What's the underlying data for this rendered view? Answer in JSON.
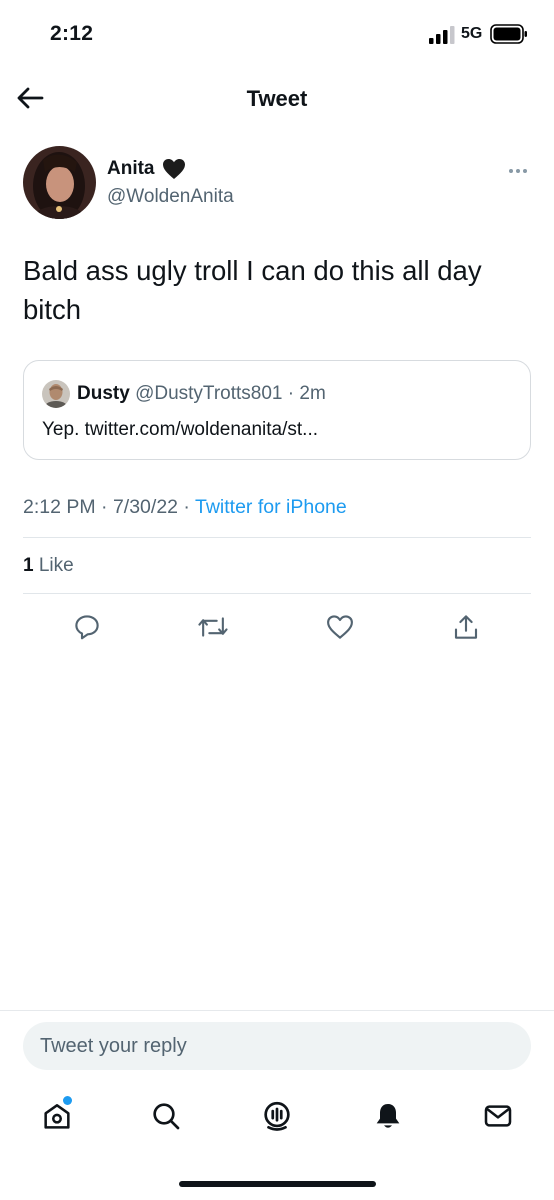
{
  "status_bar": {
    "time": "2:12",
    "network": "5G",
    "icons": [
      "signal-icon",
      "battery-icon"
    ]
  },
  "header": {
    "title": "Tweet",
    "back_icon": "arrow-left-icon"
  },
  "tweet": {
    "author_name": "Anita",
    "author_emoji": "🖤",
    "author_handle": "@WoldenAnita",
    "text": "Bald ass ugly troll I can do this all day bitch",
    "timestamp": "2:12 PM · 7/30/22 · ",
    "source": "Twitter for iPhone",
    "likes_count": "1",
    "likes_label": " Like",
    "more_icon": "more-dots-icon"
  },
  "quote": {
    "name": "Dusty",
    "handle": "@DustyTrotts801",
    "separator": " · ",
    "age": "2m",
    "text": "Yep. twitter.com/woldenanita/st..."
  },
  "actions": [
    "reply-icon",
    "retweet-icon",
    "like-icon",
    "share-icon"
  ],
  "reply": {
    "placeholder": "Tweet your reply"
  },
  "bottom_nav": [
    "home-icon",
    "search-icon",
    "spaces-icon",
    "notifications-icon",
    "messages-icon"
  ],
  "colors": {
    "accent": "#1d9bf0",
    "text": "#0f1419",
    "secondary_text": "#536471",
    "border": "#d7dbdf"
  }
}
